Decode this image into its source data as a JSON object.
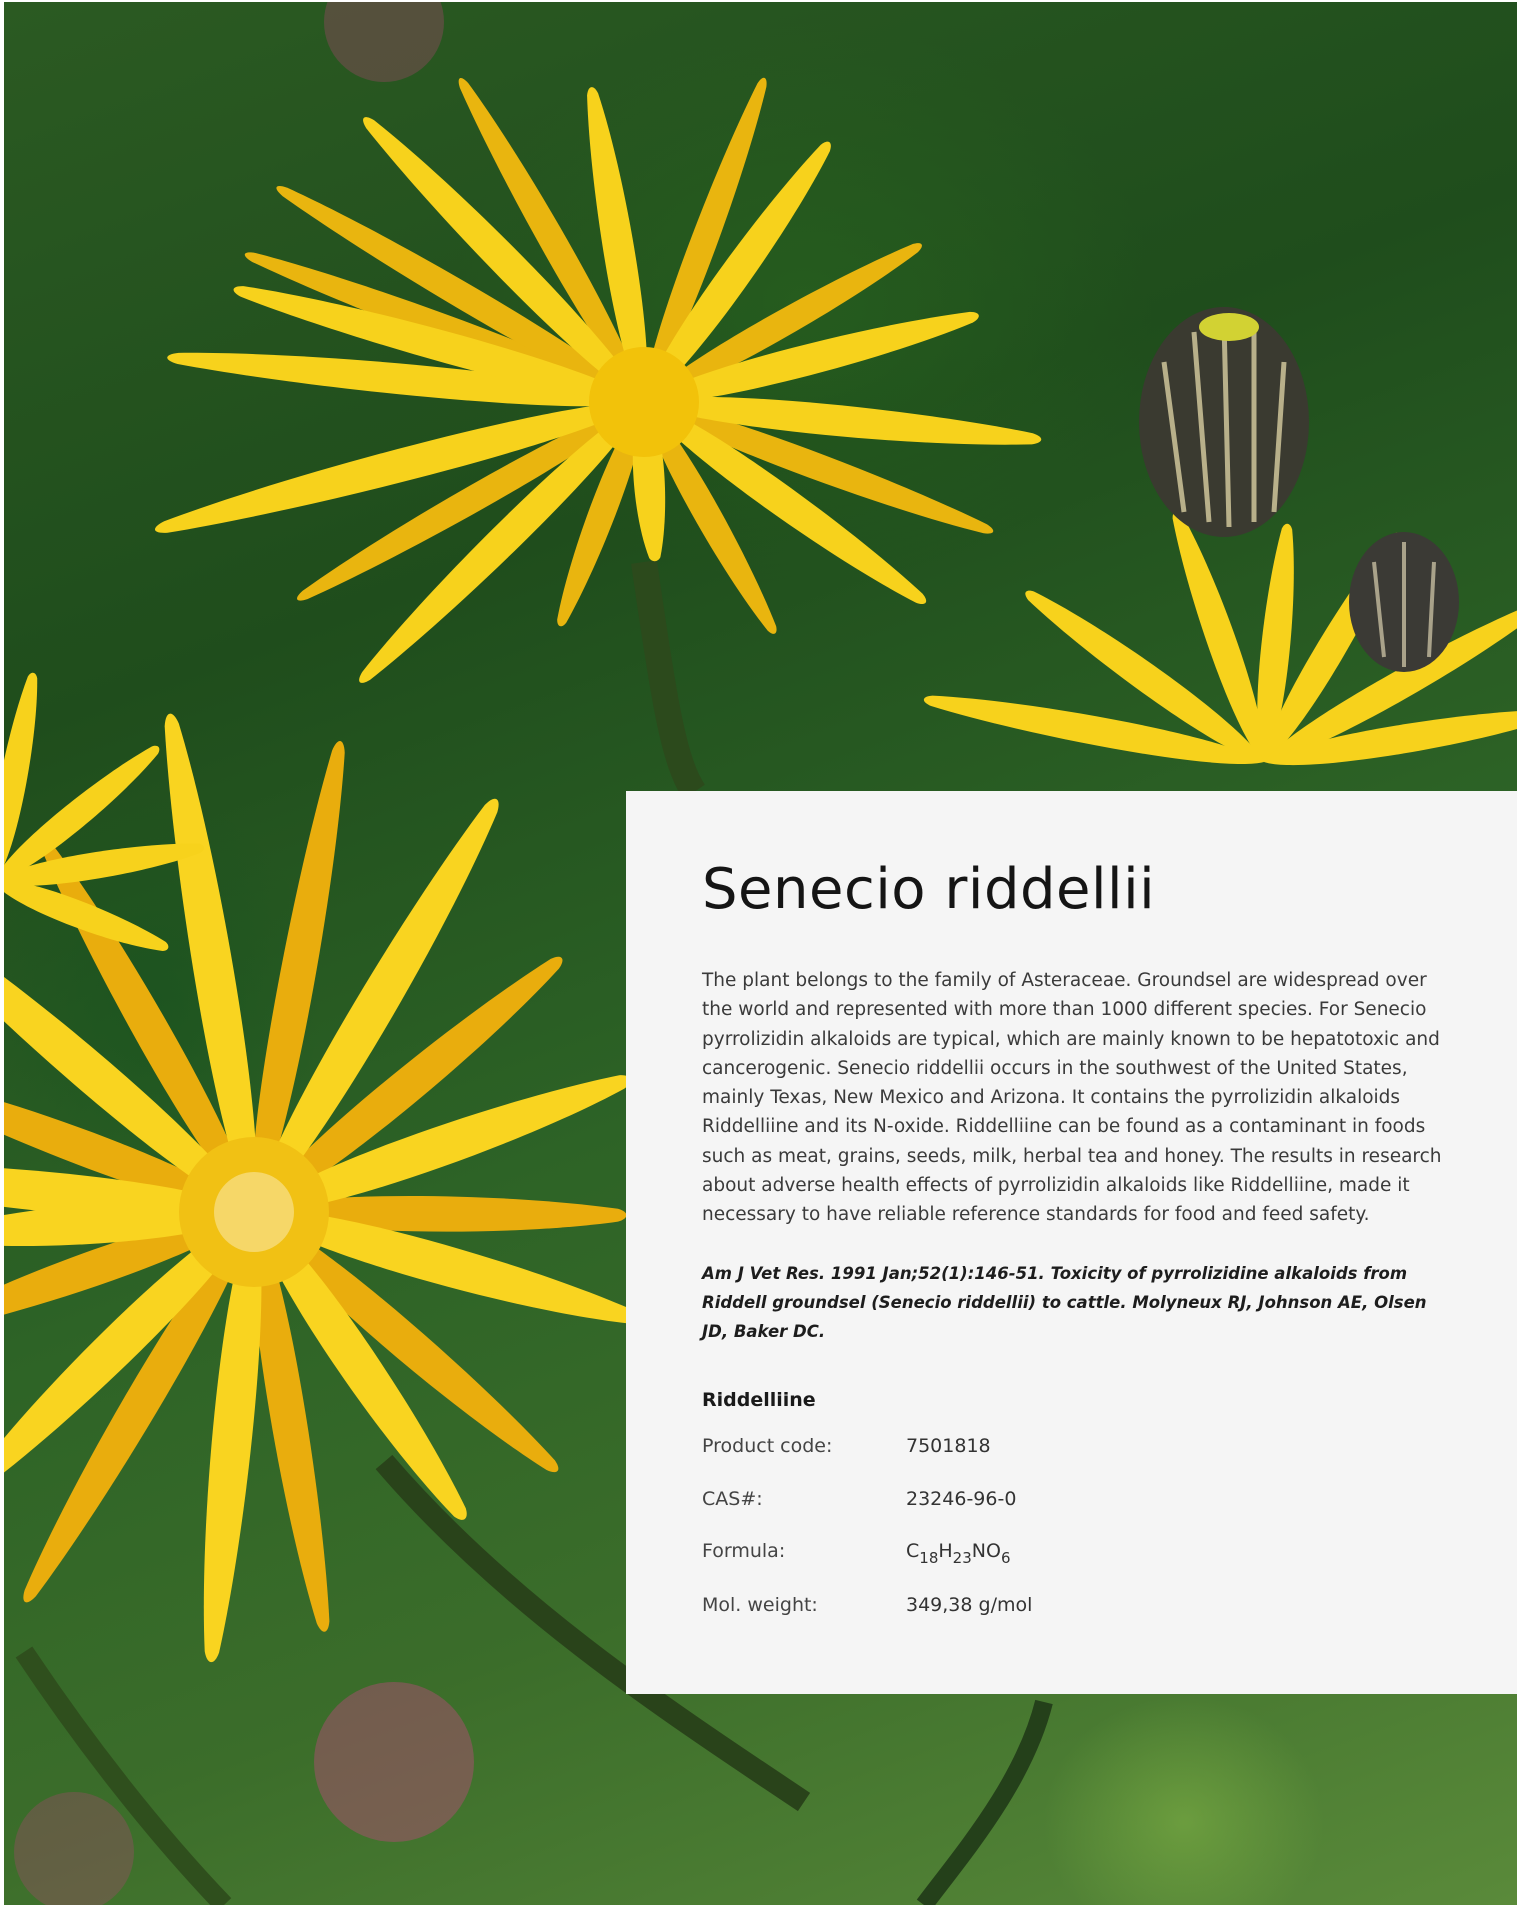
{
  "photo": {
    "subject": "yellow Senecio riddellii flowers on green background"
  },
  "heading": {
    "title": "Senecio riddellii"
  },
  "description": "The plant belongs to the family of Asteraceae. Groundsel are widespread over the world and represented with more than 1000 different species. For Senecio pyrrolizidin alkaloids are typical, which are mainly known to be hepatotoxic and cancerogenic. Senecio riddellii occurs in the southwest of the United States, mainly Texas, New Mexico and Arizona. It contains the pyrrolizidin alkaloids Riddelliine and its N-oxide. Riddelliine can be found as a contaminant in foods such as meat, grains, seeds, milk, herbal tea and honey. The results in research about adverse health effects of pyrrolizidin alkaloids like Riddelliine, made it necessary to have reliable reference standards for food and feed safety.",
  "reference": "Am J Vet Res. 1991 Jan;52(1):146-51. Toxicity of pyrrolizidine alkaloids from Riddell groundsel (Senecio riddellii) to cattle. Molyneux RJ, Johnson AE, Olsen JD, Baker DC.",
  "product": {
    "name": "Riddelliine",
    "specs": {
      "product_code_label": "Product code:",
      "product_code": "7501818",
      "cas_label": "CAS#:",
      "cas": "23246-96-0",
      "formula_label": "Formula:",
      "formula": {
        "c": "C",
        "c_n": "18",
        "h": "H",
        "h_n": "23",
        "rest": "NO",
        "o_n": "6"
      },
      "mol_weight_label": "Mol. weight:",
      "mol_weight": "349,38 g/mol"
    }
  },
  "colors": {
    "panel_background": "#f5f5f5",
    "petal_yellow": "#f7d21c",
    "foliage_green": "#2b5a22"
  }
}
